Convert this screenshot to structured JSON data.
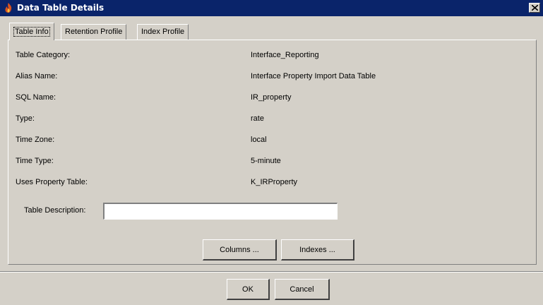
{
  "window": {
    "title": "Data Table Details",
    "close_icon": "close-icon",
    "app_icon": "flame-icon"
  },
  "tabs": [
    {
      "label": "Table Info",
      "active": true
    },
    {
      "label": "Retention Profile",
      "active": false
    },
    {
      "label": "Index Profile",
      "active": false
    }
  ],
  "fields": [
    {
      "label": "Table Category:",
      "value": "Interface_Reporting"
    },
    {
      "label": "Alias Name:",
      "value": "Interface Property Import Data Table"
    },
    {
      "label": "SQL Name:",
      "value": "IR_property"
    },
    {
      "label": "Type:",
      "value": "rate"
    },
    {
      "label": "Time Zone:",
      "value": "local"
    },
    {
      "label": "Time Type:",
      "value": "5-minute"
    },
    {
      "label": "Uses Property Table:",
      "value": "K_IRProperty"
    }
  ],
  "description": {
    "label": "Table Description:",
    "value": ""
  },
  "buttons": {
    "columns": "Columns ...",
    "indexes": "Indexes ...",
    "ok": "OK",
    "cancel": "Cancel"
  },
  "colors": {
    "title_bar": "#0a246a",
    "dialog_bg": "#d4d0c8"
  }
}
